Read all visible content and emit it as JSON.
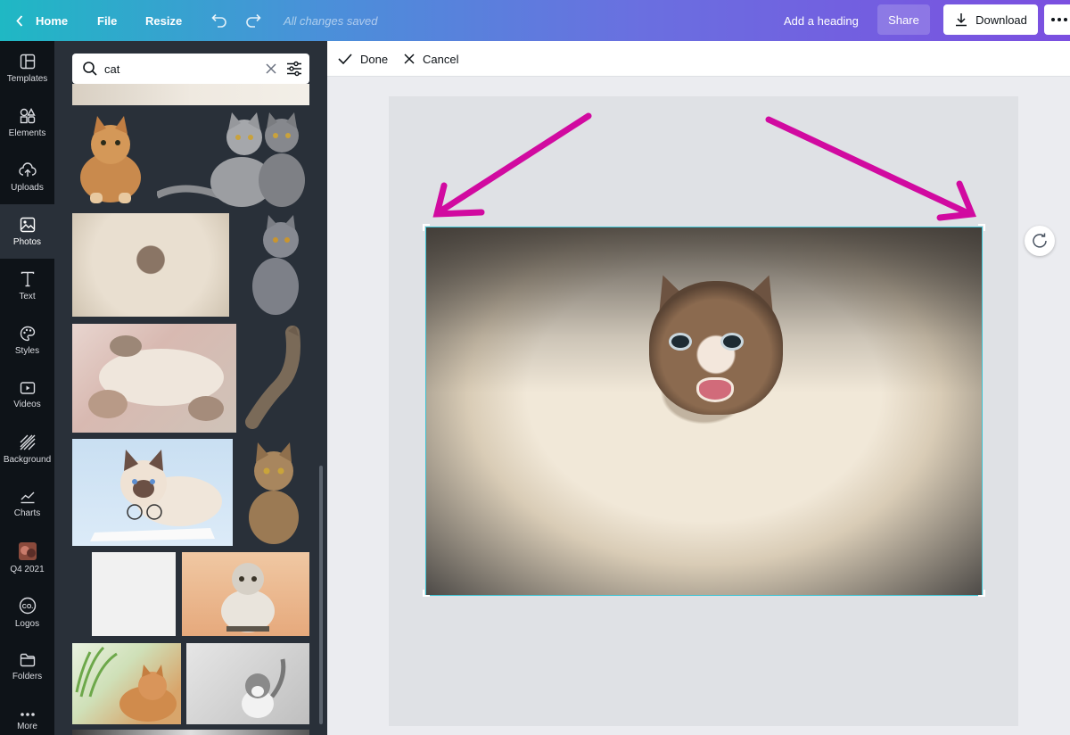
{
  "topbar": {
    "home_label": "Home",
    "file_label": "File",
    "resize_label": "Resize",
    "saved_status": "All changes saved",
    "heading_label": "Add a heading",
    "share_label": "Share",
    "download_label": "Download"
  },
  "rail": {
    "items": [
      {
        "label": "Templates",
        "icon": "templates-icon"
      },
      {
        "label": "Elements",
        "icon": "elements-icon"
      },
      {
        "label": "Uploads",
        "icon": "uploads-icon"
      },
      {
        "label": "Photos",
        "icon": "photos-icon",
        "active": true
      },
      {
        "label": "Text",
        "icon": "text-icon"
      },
      {
        "label": "Styles",
        "icon": "styles-icon"
      },
      {
        "label": "Videos",
        "icon": "videos-icon"
      },
      {
        "label": "Background",
        "icon": "background-icon"
      },
      {
        "label": "Charts",
        "icon": "charts-icon"
      },
      {
        "label": "Q4 2021",
        "icon": "folder-thumb-icon"
      },
      {
        "label": "Logos",
        "icon": "logos-icon"
      },
      {
        "label": "Folders",
        "icon": "folders-icon"
      },
      {
        "label": "More",
        "icon": "more-icon"
      }
    ]
  },
  "panel": {
    "search_value": "cat"
  },
  "cropbar": {
    "done_label": "Done",
    "cancel_label": "Cancel"
  },
  "colors": {
    "accent": "#3ec4d4",
    "annotation_arrow": "#d10aa0",
    "rail_bg": "#0e1318",
    "panel_bg": "#293039"
  }
}
